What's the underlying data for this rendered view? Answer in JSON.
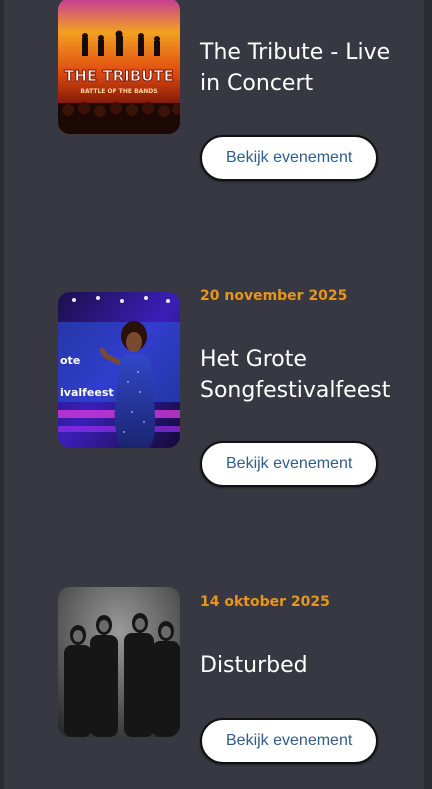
{
  "events": [
    {
      "date": "",
      "title": "The Tribute - Live in Concert",
      "button_label": "Bekijk evenement",
      "poster_text": "THE TRIBUTE",
      "poster_subtext": "BATTLE OF THE BANDS"
    },
    {
      "date": "20 november 2025",
      "title": "Het Grote Songfestivalfeest",
      "button_label": "Bekijk evenement",
      "poster_text": "ote",
      "poster_subtext": "ivalfeest"
    },
    {
      "date": "14 oktober 2025",
      "title": "Disturbed",
      "button_label": "Bekijk evenement"
    }
  ],
  "colors": {
    "date": "#e8961a",
    "panel": "#383843",
    "button_text": "#2f5d8c"
  }
}
